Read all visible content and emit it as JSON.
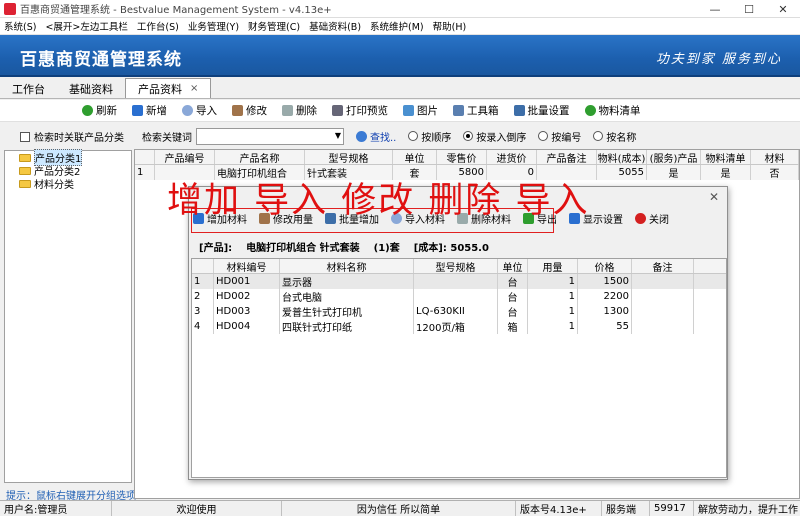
{
  "window": {
    "title": "百惠商贸通管理系统 - Bestvalue Management System - v4.13e+",
    "minimize": "—",
    "maximize": "☐",
    "close": "✕"
  },
  "menu": [
    "系统(S)",
    "<展开>左边工具栏",
    "工作台(S)",
    "业务管理(Y)",
    "财务管理(C)",
    "基础资料(B)",
    "系统维护(M)",
    "帮助(H)"
  ],
  "banner": {
    "title": "百惠商贸通管理系统",
    "slogan": "功夫到家 服务到心"
  },
  "tabs": [
    {
      "label": "工作台"
    },
    {
      "label": "基础资料"
    },
    {
      "label": "产品资料",
      "close": "×"
    }
  ],
  "toolbar": [
    "刷新",
    "新增",
    "导入",
    "修改",
    "删除",
    "打印预览",
    "图片",
    "工具箱",
    "批量设置",
    "物料清单"
  ],
  "left": {
    "checkbox_label": "检索时关联产品分类",
    "tree": [
      "产品分类1",
      "产品分类2",
      "材料分类"
    ],
    "hint": "提示：鼠标右键展开分组选项"
  },
  "search": {
    "label": "检索关键词",
    "value": "",
    "find": "查找..",
    "radios": [
      {
        "label": "按顺序",
        "checked": false
      },
      {
        "label": "按录入倒序",
        "checked": true
      },
      {
        "label": "按编号",
        "checked": false
      },
      {
        "label": "按名称",
        "checked": false
      }
    ]
  },
  "product_grid": {
    "columns": [
      "",
      "产品编号",
      "产品名称",
      "型号规格",
      "单位",
      "零售价",
      "进货价",
      "产品备注",
      "物料(成本)",
      "(服务)产品",
      "物料清单",
      "材料"
    ],
    "rows": [
      [
        "1",
        "",
        "电脑打印机组合",
        "针式套装",
        "套",
        "5800",
        "0",
        "",
        "5055",
        "是",
        "是",
        "否"
      ]
    ]
  },
  "overlay_text": "增加 导入 修改 删除 导入",
  "dialog": {
    "close": "✕",
    "toolbar": [
      "增加材料",
      "修改用量",
      "批量增加",
      "导入材料",
      "删除材料",
      "导出",
      "显示设置",
      "关闭"
    ],
    "product_label": "[产品]:",
    "product_name": "电脑打印机组合 针式套装",
    "qty": "(1)套",
    "cost": "[成本]: 5055.0",
    "columns": [
      "",
      "材料编号",
      "材料名称",
      "型号规格",
      "单位",
      "用量",
      "价格",
      "备注"
    ],
    "rows": [
      [
        "1",
        "HD001",
        "显示器",
        "",
        "台",
        "1",
        "1500",
        ""
      ],
      [
        "2",
        "HD002",
        "台式电脑",
        "",
        "台",
        "1",
        "2200",
        ""
      ],
      [
        "3",
        "HD003",
        "爱普生针式打印机",
        "LQ-630KII",
        "台",
        "1",
        "1300",
        ""
      ],
      [
        "4",
        "HD004",
        "四联针式打印纸",
        "1200页/箱",
        "箱",
        "1",
        "55",
        ""
      ]
    ]
  },
  "status": [
    "用户名:管理员",
    "欢迎使用",
    "因为信任 所以简单",
    "版本号4.13e+",
    "服务端",
    "59917",
    "解放劳动力，提升工作"
  ],
  "colors": {
    "banner": "#1c5fae",
    "overlay": "#e01010",
    "hint": "#1f5fb4"
  }
}
